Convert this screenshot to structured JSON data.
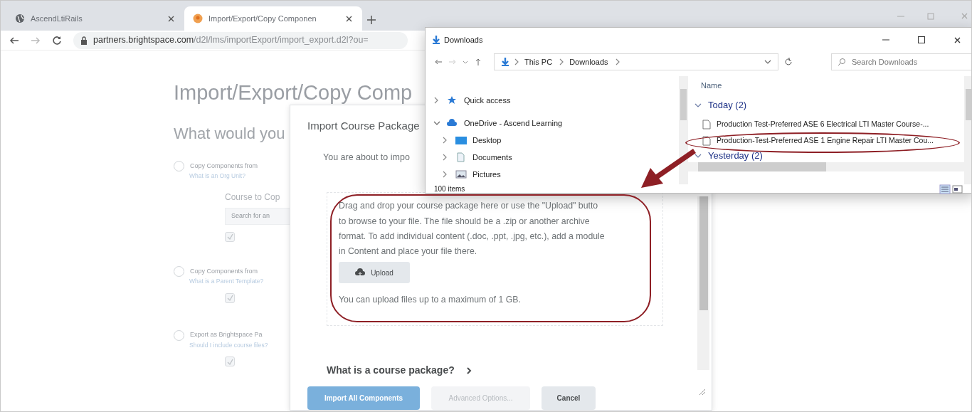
{
  "browser": {
    "tabs": [
      {
        "title": "AscendLtiRails",
        "selected": false
      },
      {
        "title": "Import/Export/Copy Componen",
        "selected": true
      }
    ],
    "url_host": "partners.brightspace.com",
    "url_path": "/d2l/lms/importExport/import_export.d2l?ou="
  },
  "page": {
    "title": "Import/Export/Copy Comp",
    "subtitle": "What would you",
    "options": [
      {
        "label": "Copy Components from",
        "help_link": "What is an Org Unit?",
        "field_label": "Course to Cop",
        "field_placeholder": "Search for an",
        "selected": false,
        "checked": true
      },
      {
        "label": "Copy Components from",
        "help_link": "What is a Parent Template?",
        "selected": false,
        "checked": true
      },
      {
        "label": "Export as Brightspace Pa",
        "help_link": "Should I include course files?",
        "selected": false,
        "checked": true
      }
    ]
  },
  "dialog": {
    "title": "Import Course Package",
    "intro": "You are about to impo",
    "dropzone_lines": [
      "Drag and drop your course package here or use the \"Upload\" butto",
      "to browse to your file. The file should be a .zip or another archive",
      "format. To add individual content (.doc, .ppt, .jpg, etc.), add a module",
      "in Content and place your file there."
    ],
    "upload_button": "Upload",
    "limit": "You can upload files up to a maximum of 1 GB.",
    "help": "What is a course package?",
    "buttons": [
      {
        "label": "Import All Components",
        "kind": "primary"
      },
      {
        "label": "Advanced Options...",
        "kind": "disabled"
      },
      {
        "label": "Cancel",
        "kind": "secondary"
      }
    ]
  },
  "explorer": {
    "title": "Downloads",
    "breadcrumb": [
      "This PC",
      "Downloads"
    ],
    "search_placeholder": "Search Downloads",
    "nav": [
      {
        "label": "Quick access",
        "expanded": false
      },
      {
        "label": "OneDrive - Ascend Learning",
        "expanded": true,
        "children": [
          {
            "label": "Desktop",
            "expanded": false
          },
          {
            "label": "Documents",
            "expanded": false
          },
          {
            "label": "Pictures",
            "expanded": false
          }
        ]
      }
    ],
    "column": "Name",
    "groups": [
      {
        "label": "Today (2)",
        "expanded": true,
        "files": [
          "Production Test-Preferred ASE 6 Electrical LTI Master Course-...",
          "Production-Test-Preferred ASE 1 Engine Repair LTI Master Cou..."
        ]
      },
      {
        "label": "Yesterday (2)",
        "expanded": true
      }
    ],
    "status": "100 items"
  }
}
